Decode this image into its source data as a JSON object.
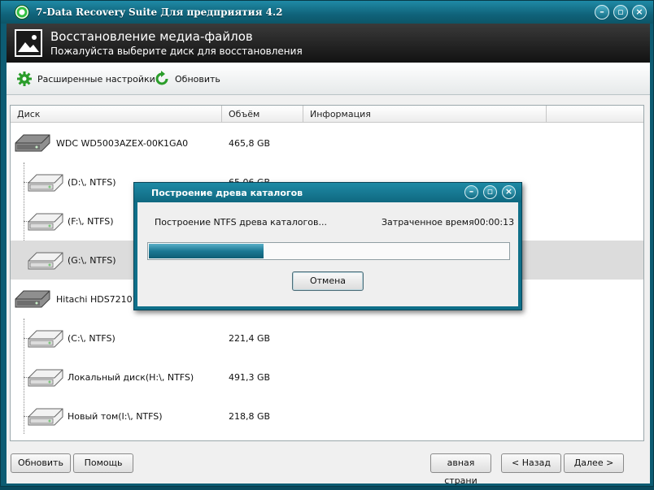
{
  "window": {
    "title": "7-Data Recovery Suite Для предприятия 4.2",
    "controls": [
      "minimize-icon",
      "maximize-icon",
      "close-icon"
    ]
  },
  "header": {
    "title": "Восстановление медиа-файлов",
    "subtitle": "Пожалуйста выберите диск для восстановления",
    "icon": "image-icon"
  },
  "toolbar": {
    "advanced_settings": "Расширенные настройки",
    "refresh": "Обновить"
  },
  "table": {
    "columns": [
      "Диск",
      "Объём",
      "Информация"
    ],
    "rows": [
      {
        "name": "WDC WD5003AZEX-00K1GA0",
        "size": "465,8 GB",
        "type": "disk",
        "selected": false
      },
      {
        "name": "(D:\\, NTFS)",
        "size": "65,06 GB",
        "type": "partition",
        "selected": false
      },
      {
        "name": "(F:\\, NTFS)",
        "size": "",
        "type": "partition",
        "selected": false
      },
      {
        "name": "(G:\\, NTFS)",
        "size": "",
        "type": "partition",
        "selected": true
      },
      {
        "name": "Hitachi HDS721010",
        "size": "",
        "type": "disk",
        "selected": false
      },
      {
        "name": "(C:\\, NTFS)",
        "size": "221,4 GB",
        "type": "partition",
        "selected": false
      },
      {
        "name": "Локальный диск(H:\\, NTFS)",
        "size": "491,3 GB",
        "type": "partition",
        "selected": false
      },
      {
        "name": "Новый том(I:\\, NTFS)",
        "size": "218,8 GB",
        "type": "partition",
        "selected": false
      }
    ]
  },
  "footer": {
    "refresh": "Обновить",
    "help": "Помощь",
    "home": "авная страни",
    "back": "< Назад",
    "next": "Далее >"
  },
  "dialog": {
    "title": "Построение древа каталогов",
    "message": "Построение NTFS древа каталогов...",
    "elapsed_label": "Затраченное время",
    "elapsed_value": "00:00:13",
    "progress": 0.32,
    "cancel": "Отмена"
  },
  "colors": {
    "accent": "#0f6f89",
    "header_bg": "#1a1a1a",
    "selected_row": "#dcdcdc",
    "green_icon": "#2a9d2a"
  }
}
